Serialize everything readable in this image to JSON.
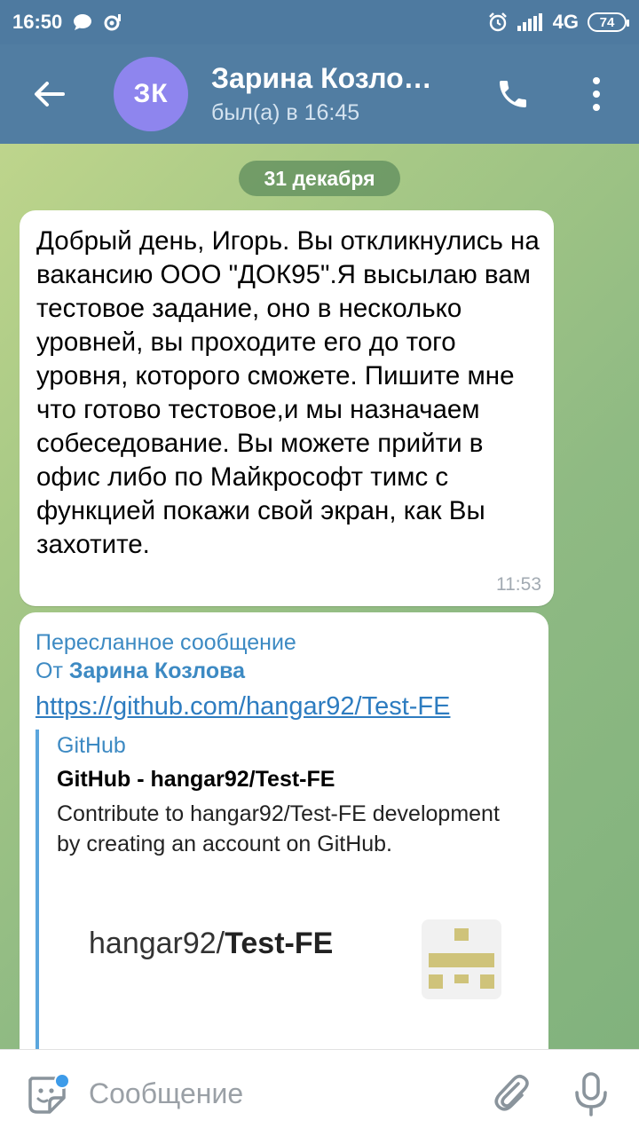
{
  "status_bar": {
    "time": "16:50",
    "network": "4G",
    "battery": "74",
    "icons": [
      "chat-bubble-icon",
      "shield-icon",
      "alarm-icon",
      "signal-icon"
    ]
  },
  "header": {
    "avatar_initials": "ЗК",
    "contact_name": "Зарина Козло…",
    "last_seen": "был(а) в 16:45",
    "avatar_color": "#8e85ee",
    "bar_color": "#517da2"
  },
  "date_separator": "31 декабря",
  "message1": {
    "text": "Добрый день, Игорь. Вы откликнулись на вакансию ООО \"ДОК95\".Я высылаю вам тестовое задание, оно в несколько уровней, вы проходите его до того уровня, которого сможете. Пишите мне что готово тестовое,и мы назначаем собеседование. Вы можете прийти в офис либо по Майкрософт тимс с функцией покажи свой экран, как Вы захотите.",
    "time": "11:53"
  },
  "message2": {
    "forwarded_label": "Пересланное сообщение",
    "from_prefix": "От",
    "from_name": "Зарина Козлова",
    "link": "https://github.com/hangar92/Test-FE",
    "preview": {
      "site": "GitHub",
      "title": "GitHub - hangar92/Test-FE",
      "description": "Contribute to hangar92/Test-FE development by creating an account on GitHub.",
      "repo_owner": "hangar92/",
      "repo_name": "Test-FE"
    }
  },
  "composer": {
    "placeholder": "Сообщение"
  }
}
